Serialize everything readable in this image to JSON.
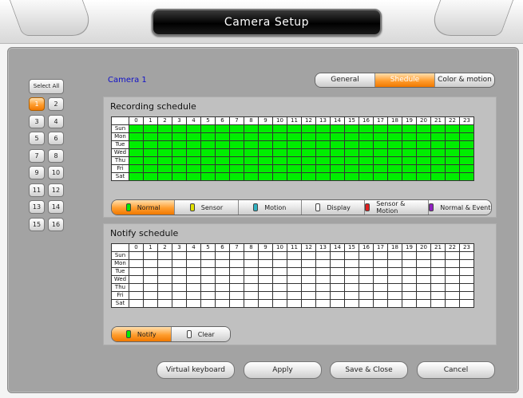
{
  "window": {
    "title": "Camera Setup"
  },
  "camera_select": {
    "select_all_label": "Select All",
    "buttons": [
      "1",
      "2",
      "3",
      "4",
      "5",
      "6",
      "7",
      "8",
      "9",
      "10",
      "11",
      "12",
      "13",
      "14",
      "15",
      "16"
    ],
    "selected": "1"
  },
  "camera_label": "Camera 1",
  "tabs": [
    {
      "label": "General",
      "active": false
    },
    {
      "label": "Shedule",
      "active": true
    },
    {
      "label": "Color & motion",
      "active": false
    }
  ],
  "recording": {
    "title": "Recording schedule",
    "hours": [
      "0",
      "1",
      "2",
      "3",
      "4",
      "5",
      "6",
      "7",
      "8",
      "9",
      "10",
      "11",
      "12",
      "13",
      "14",
      "15",
      "16",
      "17",
      "18",
      "19",
      "20",
      "21",
      "22",
      "23"
    ],
    "days": [
      "Sun",
      "Mon",
      "Tue",
      "Wed",
      "Thu",
      "Fri",
      "Sat"
    ],
    "fill_mode": "Normal",
    "fill_color": "#00ee00",
    "modes": [
      {
        "label": "Normal",
        "color": "#00ee00",
        "active": true
      },
      {
        "label": "Sensor",
        "color": "#e0e000",
        "active": false
      },
      {
        "label": "Motion",
        "color": "#30b0c0",
        "active": false
      },
      {
        "label": "Display",
        "color": "#ffffff",
        "active": false
      },
      {
        "label": "Sensor & Motion",
        "color": "#e02020",
        "active": false
      },
      {
        "label": "Normal & Event",
        "color": "#9020c0",
        "active": false
      }
    ]
  },
  "notify": {
    "title": "Notify schedule",
    "hours": [
      "0",
      "1",
      "2",
      "3",
      "4",
      "5",
      "6",
      "7",
      "8",
      "9",
      "10",
      "11",
      "12",
      "13",
      "14",
      "15",
      "16",
      "17",
      "18",
      "19",
      "20",
      "21",
      "22",
      "23"
    ],
    "days": [
      "Sun",
      "Mon",
      "Tue",
      "Wed",
      "Thu",
      "Fri",
      "Sat"
    ],
    "modes": [
      {
        "label": "Notify",
        "color": "#00ee00",
        "active": true
      },
      {
        "label": "Clear",
        "color": "#ffffff",
        "active": false
      }
    ]
  },
  "footer": {
    "virtual_keyboard": "Virtual keyboard",
    "apply": "Apply",
    "save_close": "Save & Close",
    "cancel": "Cancel"
  }
}
